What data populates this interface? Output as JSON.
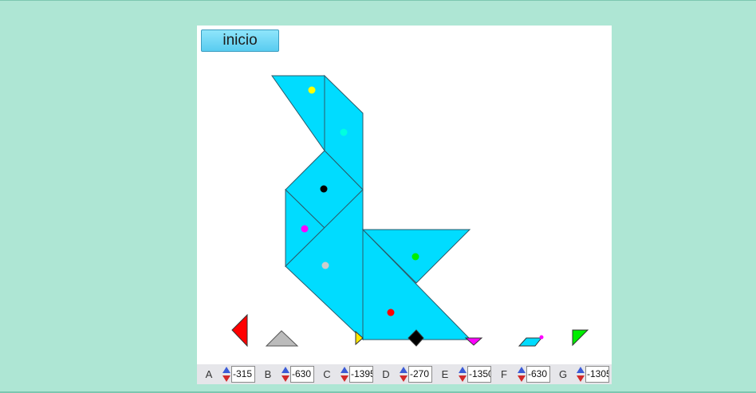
{
  "app": {
    "start_button_label": "inicio"
  },
  "colors": {
    "page_background": "#aee6d4",
    "figure_fill": "#00dcff",
    "piece_A": "#ff0000",
    "piece_B": "#bbbbbb",
    "piece_C": "#ffe600",
    "piece_D": "#000000",
    "piece_E": "#ff00ff",
    "piece_F": "#00dcff",
    "piece_G": "#00ff00"
  },
  "controls": [
    {
      "label": "A",
      "value": "-315"
    },
    {
      "label": "B",
      "value": "-630"
    },
    {
      "label": "C",
      "value": "-1395"
    },
    {
      "label": "D",
      "value": "-270"
    },
    {
      "label": "E",
      "value": "-1350"
    },
    {
      "label": "F",
      "value": "-630"
    },
    {
      "label": "G",
      "value": "-1305"
    }
  ]
}
